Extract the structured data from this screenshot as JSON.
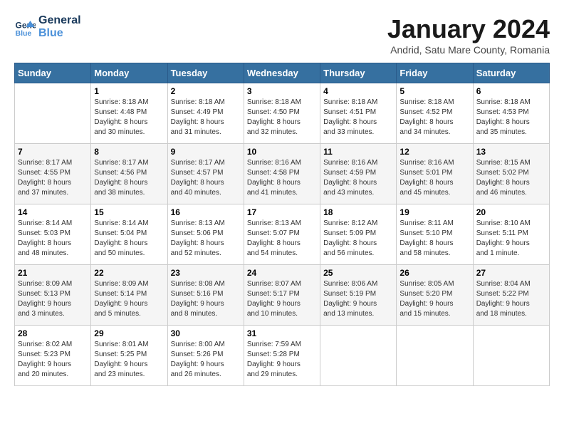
{
  "logo": {
    "line1": "General",
    "line2": "Blue"
  },
  "title": "January 2024",
  "subtitle": "Andrid, Satu Mare County, Romania",
  "headers": [
    "Sunday",
    "Monday",
    "Tuesday",
    "Wednesday",
    "Thursday",
    "Friday",
    "Saturday"
  ],
  "weeks": [
    [
      {
        "day": "",
        "info": ""
      },
      {
        "day": "1",
        "info": "Sunrise: 8:18 AM\nSunset: 4:48 PM\nDaylight: 8 hours\nand 30 minutes."
      },
      {
        "day": "2",
        "info": "Sunrise: 8:18 AM\nSunset: 4:49 PM\nDaylight: 8 hours\nand 31 minutes."
      },
      {
        "day": "3",
        "info": "Sunrise: 8:18 AM\nSunset: 4:50 PM\nDaylight: 8 hours\nand 32 minutes."
      },
      {
        "day": "4",
        "info": "Sunrise: 8:18 AM\nSunset: 4:51 PM\nDaylight: 8 hours\nand 33 minutes."
      },
      {
        "day": "5",
        "info": "Sunrise: 8:18 AM\nSunset: 4:52 PM\nDaylight: 8 hours\nand 34 minutes."
      },
      {
        "day": "6",
        "info": "Sunrise: 8:18 AM\nSunset: 4:53 PM\nDaylight: 8 hours\nand 35 minutes."
      }
    ],
    [
      {
        "day": "7",
        "info": "Sunrise: 8:17 AM\nSunset: 4:55 PM\nDaylight: 8 hours\nand 37 minutes."
      },
      {
        "day": "8",
        "info": "Sunrise: 8:17 AM\nSunset: 4:56 PM\nDaylight: 8 hours\nand 38 minutes."
      },
      {
        "day": "9",
        "info": "Sunrise: 8:17 AM\nSunset: 4:57 PM\nDaylight: 8 hours\nand 40 minutes."
      },
      {
        "day": "10",
        "info": "Sunrise: 8:16 AM\nSunset: 4:58 PM\nDaylight: 8 hours\nand 41 minutes."
      },
      {
        "day": "11",
        "info": "Sunrise: 8:16 AM\nSunset: 4:59 PM\nDaylight: 8 hours\nand 43 minutes."
      },
      {
        "day": "12",
        "info": "Sunrise: 8:16 AM\nSunset: 5:01 PM\nDaylight: 8 hours\nand 45 minutes."
      },
      {
        "day": "13",
        "info": "Sunrise: 8:15 AM\nSunset: 5:02 PM\nDaylight: 8 hours\nand 46 minutes."
      }
    ],
    [
      {
        "day": "14",
        "info": "Sunrise: 8:14 AM\nSunset: 5:03 PM\nDaylight: 8 hours\nand 48 minutes."
      },
      {
        "day": "15",
        "info": "Sunrise: 8:14 AM\nSunset: 5:04 PM\nDaylight: 8 hours\nand 50 minutes."
      },
      {
        "day": "16",
        "info": "Sunrise: 8:13 AM\nSunset: 5:06 PM\nDaylight: 8 hours\nand 52 minutes."
      },
      {
        "day": "17",
        "info": "Sunrise: 8:13 AM\nSunset: 5:07 PM\nDaylight: 8 hours\nand 54 minutes."
      },
      {
        "day": "18",
        "info": "Sunrise: 8:12 AM\nSunset: 5:09 PM\nDaylight: 8 hours\nand 56 minutes."
      },
      {
        "day": "19",
        "info": "Sunrise: 8:11 AM\nSunset: 5:10 PM\nDaylight: 8 hours\nand 58 minutes."
      },
      {
        "day": "20",
        "info": "Sunrise: 8:10 AM\nSunset: 5:11 PM\nDaylight: 9 hours\nand 1 minute."
      }
    ],
    [
      {
        "day": "21",
        "info": "Sunrise: 8:09 AM\nSunset: 5:13 PM\nDaylight: 9 hours\nand 3 minutes."
      },
      {
        "day": "22",
        "info": "Sunrise: 8:09 AM\nSunset: 5:14 PM\nDaylight: 9 hours\nand 5 minutes."
      },
      {
        "day": "23",
        "info": "Sunrise: 8:08 AM\nSunset: 5:16 PM\nDaylight: 9 hours\nand 8 minutes."
      },
      {
        "day": "24",
        "info": "Sunrise: 8:07 AM\nSunset: 5:17 PM\nDaylight: 9 hours\nand 10 minutes."
      },
      {
        "day": "25",
        "info": "Sunrise: 8:06 AM\nSunset: 5:19 PM\nDaylight: 9 hours\nand 13 minutes."
      },
      {
        "day": "26",
        "info": "Sunrise: 8:05 AM\nSunset: 5:20 PM\nDaylight: 9 hours\nand 15 minutes."
      },
      {
        "day": "27",
        "info": "Sunrise: 8:04 AM\nSunset: 5:22 PM\nDaylight: 9 hours\nand 18 minutes."
      }
    ],
    [
      {
        "day": "28",
        "info": "Sunrise: 8:02 AM\nSunset: 5:23 PM\nDaylight: 9 hours\nand 20 minutes."
      },
      {
        "day": "29",
        "info": "Sunrise: 8:01 AM\nSunset: 5:25 PM\nDaylight: 9 hours\nand 23 minutes."
      },
      {
        "day": "30",
        "info": "Sunrise: 8:00 AM\nSunset: 5:26 PM\nDaylight: 9 hours\nand 26 minutes."
      },
      {
        "day": "31",
        "info": "Sunrise: 7:59 AM\nSunset: 5:28 PM\nDaylight: 9 hours\nand 29 minutes."
      },
      {
        "day": "",
        "info": ""
      },
      {
        "day": "",
        "info": ""
      },
      {
        "day": "",
        "info": ""
      }
    ]
  ]
}
